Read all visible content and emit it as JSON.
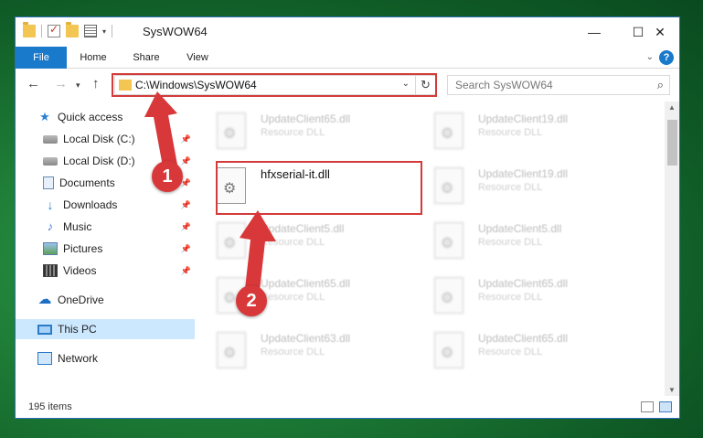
{
  "window": {
    "title": "SysWOW64",
    "controls": {
      "minimize": "—",
      "maximize": "☐",
      "close": "✕"
    }
  },
  "ribbon": {
    "tabs": [
      "File",
      "Home",
      "Share",
      "View"
    ],
    "help": "?"
  },
  "address_bar": {
    "path": "C:\\Windows\\SysWOW64",
    "search_placeholder": "Search SysWOW64"
  },
  "nav_pane": {
    "items": [
      {
        "label": "Quick access",
        "icon": "star-icon"
      },
      {
        "label": "Local Disk (C:)",
        "icon": "disk-icon",
        "pinned": true
      },
      {
        "label": "Local Disk (D:)",
        "icon": "disk-icon",
        "pinned": true
      },
      {
        "label": "Documents",
        "icon": "documents-icon",
        "pinned": true
      },
      {
        "label": "Downloads",
        "icon": "download-icon",
        "pinned": true
      },
      {
        "label": "Music",
        "icon": "music-icon",
        "pinned": true
      },
      {
        "label": "Pictures",
        "icon": "pictures-icon",
        "pinned": true
      },
      {
        "label": "Videos",
        "icon": "videos-icon",
        "pinned": true
      },
      {
        "label": "OneDrive",
        "icon": "cloud-icon"
      },
      {
        "label": "This PC",
        "icon": "pc-icon",
        "selected": true
      },
      {
        "label": "Network",
        "icon": "network-icon"
      }
    ]
  },
  "files": {
    "highlighted": {
      "name": "hfxserial-it.dll"
    },
    "left_column": [
      {
        "name": "UpdateClient65.dll",
        "type": "Resource DLL"
      },
      {
        "name": "UpdateClient5.dll",
        "type": "Resource DLL"
      },
      {
        "name": "UpdateClient65.dll",
        "type": "Resource DLL"
      },
      {
        "name": "UpdateClient63.dll",
        "type": "Resource DLL"
      }
    ],
    "right_column": [
      {
        "name": "UpdateClient19.dll",
        "type": "Resource DLL"
      },
      {
        "name": "UpdateClient19.dll",
        "type": "Resource DLL"
      },
      {
        "name": "UpdateClient5.dll",
        "type": "Resource DLL"
      },
      {
        "name": "UpdateClient65.dll",
        "type": "Resource DLL"
      },
      {
        "name": "UpdateClient65.dll",
        "type": "Resource DLL"
      }
    ]
  },
  "status_bar": {
    "item_count": "195 items"
  },
  "annotations": {
    "step1": "1",
    "step2": "2",
    "color": "#d33b3b"
  }
}
